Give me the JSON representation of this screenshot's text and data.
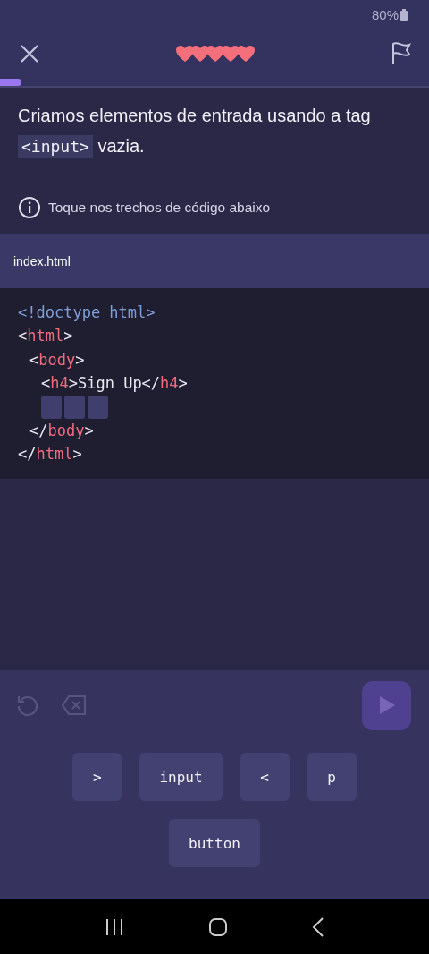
{
  "status_bar": {
    "battery": "80%"
  },
  "header": {
    "lives": [
      {
        "full": true
      },
      {
        "full": true
      },
      {
        "full": true
      },
      {
        "full": true
      },
      {
        "full": true
      }
    ],
    "progress": {
      "level": 0.05
    }
  },
  "instruction": {
    "parts": [
      {
        "kind": "text",
        "text": "Criamos elementos de entrada usando a tag "
      },
      {
        "kind": "code",
        "text": "<input>"
      },
      {
        "kind": "text",
        "text": " vazia."
      }
    ]
  },
  "hint": "Toque nos trechos de código abaixo",
  "file_tab": "index.html",
  "code_lines": [
    {
      "tokens": [
        {
          "kind": "doctype",
          "text": "<!doctype html>"
        }
      ]
    },
    {
      "tokens": [
        {
          "kind": "punct",
          "text": "<"
        },
        {
          "kind": "tag",
          "text": "html"
        },
        {
          "kind": "punct",
          "text": ">"
        }
      ],
      "children": [
        {
          "tokens": [
            {
              "kind": "punct",
              "text": "<"
            },
            {
              "kind": "tag",
              "text": "body"
            },
            {
              "kind": "punct",
              "text": ">"
            }
          ],
          "children": [
            {
              "tokens": [
                {
                  "kind": "punct",
                  "text": "<"
                },
                {
                  "kind": "tag",
                  "text": "h4"
                },
                {
                  "kind": "punct",
                  "text": ">Sign Up</"
                },
                {
                  "kind": "tag",
                  "text": "h4"
                },
                {
                  "kind": "punct",
                  "text": ">"
                }
              ]
            },
            {
              "blanks": [
                {
                  "filled": false
                },
                {
                  "filled": false
                },
                {
                  "filled": false
                }
              ]
            }
          ]
        },
        {
          "tokens": [
            {
              "kind": "punct",
              "text": "</"
            },
            {
              "kind": "tag",
              "text": "body"
            },
            {
              "kind": "punct",
              "text": ">"
            }
          ]
        }
      ]
    },
    {
      "tokens": [
        {
          "kind": "punct",
          "text": "</"
        },
        {
          "kind": "tag",
          "text": "html"
        },
        {
          "kind": "punct",
          "text": ">"
        }
      ]
    }
  ],
  "toolbar": {
    "run_disabled": true
  },
  "snippets": [
    {
      "text": ">"
    },
    {
      "text": "input"
    },
    {
      "text": "<"
    },
    {
      "text": "p"
    },
    {
      "text": "button"
    }
  ]
}
